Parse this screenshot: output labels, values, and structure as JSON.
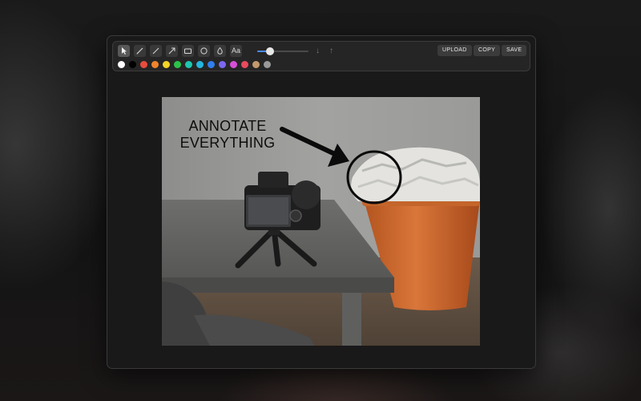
{
  "toolbar": {
    "tools": [
      {
        "name": "select",
        "icon": "cursor-icon"
      },
      {
        "name": "pen",
        "icon": "pen-icon"
      },
      {
        "name": "line",
        "icon": "line-icon"
      },
      {
        "name": "arrow",
        "icon": "arrow-icon"
      },
      {
        "name": "rectangle",
        "icon": "rectangle-icon"
      },
      {
        "name": "ellipse",
        "icon": "circle-icon"
      },
      {
        "name": "blur",
        "icon": "drop-icon"
      },
      {
        "name": "text",
        "icon": "text-icon",
        "label": "Aa"
      }
    ],
    "active_tool": "select",
    "stroke_width_level": 0.25,
    "order_buttons": {
      "down_icon": "arrow-down-icon",
      "up_icon": "arrow-up-icon"
    },
    "upload_label": "UPLOAD",
    "copy_label": "COPY",
    "save_label": "SAVE",
    "colors": [
      "#ffffff",
      "#000000",
      "#e84c3d",
      "#f0842c",
      "#f5d327",
      "#2bc24a",
      "#1ec7b0",
      "#22b7e0",
      "#2f80ed",
      "#7b68ee",
      "#d84fd8",
      "#e84a5f",
      "#c49a6c",
      "#9a9a9a"
    ]
  },
  "canvas": {
    "annotation_text_line1": "ANNOTATE",
    "annotation_text_line2": "EVERYTHING"
  }
}
